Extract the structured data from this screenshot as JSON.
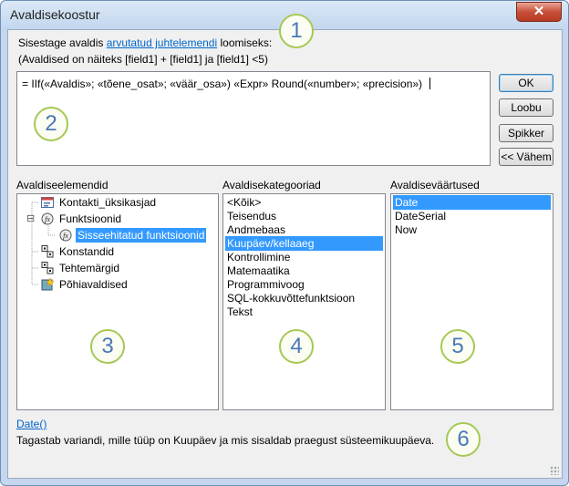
{
  "window": {
    "title": "Avaldisekoostur",
    "close_glyph": "✕"
  },
  "intro": {
    "prefix": "Sisestage avaldis ",
    "link": "arvutatud juhtelemendi",
    "suffix": " loomiseks:",
    "example": "(Avaldised on näiteks [field1] + [field1] ja [field1] <5)"
  },
  "expression": {
    "value": "= IIf(«Avaldis»; «tõene_osat»; «väär_osa») «Expr» Round(«number»; «precision»)"
  },
  "buttons": {
    "ok": "OK",
    "cancel": "Loobu",
    "help": "Spikker",
    "less": "<< Vähem"
  },
  "elements_panel": {
    "label": "Avaldiseelemendid",
    "items": [
      {
        "label": "Kontakti_üksikasjad",
        "icon": "form-icon"
      },
      {
        "label": "Funktsioonid",
        "icon": "function-icon",
        "expander": "⊟"
      },
      {
        "label": "Sisseehitatud funktsioonid",
        "icon": "function-icon",
        "selected": true
      },
      {
        "label": "Konstandid",
        "icon": "constants-icon"
      },
      {
        "label": "Tehtemärgid",
        "icon": "operators-icon"
      },
      {
        "label": "Põhiavaldised",
        "icon": "common-expressions-icon"
      }
    ]
  },
  "categories_panel": {
    "label": "Avaldisekategooriad",
    "items": [
      "<Kõik>",
      "Teisendus",
      "Andmebaas",
      "Kuupäev/kellaaeg",
      "Kontrollimine",
      "Matemaatika",
      "Programmivoog",
      "SQL-kokkuvõttefunktsioon",
      "Tekst"
    ],
    "selected": "Kuupäev/kellaaeg"
  },
  "values_panel": {
    "label": "Avaldiseväärtused",
    "items": [
      "Date",
      "DateSerial",
      "Now"
    ],
    "selected": "Date"
  },
  "help": {
    "link": "Date()",
    "text": "Tagastab variandi, mille tüüp on Kuupäev ja mis sisaldab praegust süsteemikuupäeva."
  },
  "callouts": [
    "1",
    "2",
    "3",
    "4",
    "5",
    "6"
  ],
  "colors": {
    "selection": "#3399ff",
    "callout_border": "#a6c855",
    "callout_text": "#4a78b8",
    "link": "#0066cc"
  }
}
